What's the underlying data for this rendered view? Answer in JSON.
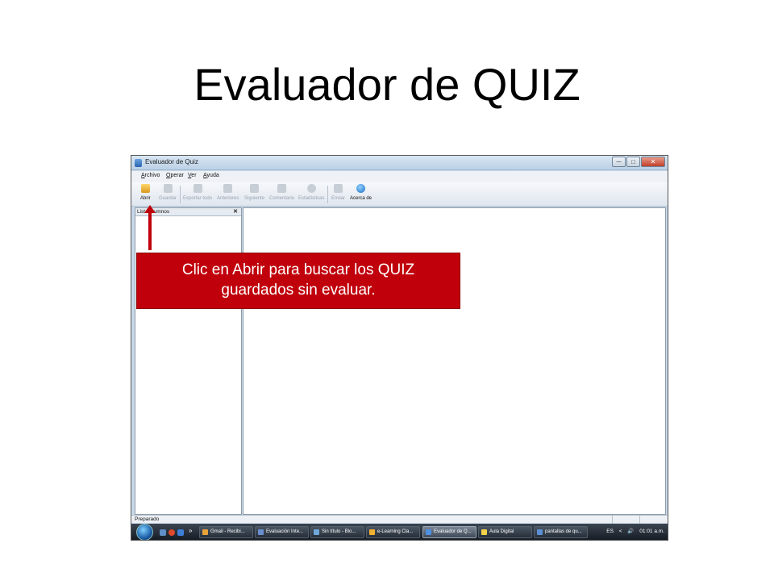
{
  "slide": {
    "title": "Evaluador de QUIZ"
  },
  "window": {
    "title": "Evaluador de Quiz",
    "controls": {
      "minimize": "─",
      "maximize": "□",
      "close": "✕"
    },
    "menu": [
      "Archivo",
      "Operar",
      "Ver",
      "Ayuda"
    ],
    "toolbar": [
      {
        "label": "Abrir",
        "icon": "folder-open-icon",
        "enabled": true
      },
      {
        "label": "Guardar",
        "icon": "save-icon",
        "enabled": false
      },
      {
        "label": "Exportar todo",
        "icon": "export-icon",
        "enabled": false
      },
      {
        "label": "Anteriores",
        "icon": "arrow-up-icon",
        "enabled": false
      },
      {
        "label": "Siguiente",
        "icon": "arrow-down-icon",
        "enabled": false
      },
      {
        "label": "Comentario",
        "icon": "comment-icon",
        "enabled": false
      },
      {
        "label": "Estadísticas",
        "icon": "stats-icon",
        "enabled": false
      },
      {
        "label": "Enviar",
        "icon": "send-icon",
        "enabled": false
      },
      {
        "label": "Acerca de",
        "icon": "help-icon",
        "enabled": true
      }
    ],
    "panel": {
      "title": "Lista alumnos",
      "close": "✕"
    },
    "status": "Preparado"
  },
  "taskbar": {
    "quicklaunch_more": "»",
    "tasks": [
      {
        "label": "Gmail - Recibi...",
        "color": "#e8a33a"
      },
      {
        "label": "Evaluación Inte...",
        "color": "#6a8fd0"
      },
      {
        "label": "Sin título - Blo...",
        "color": "#6fa8dc"
      },
      {
        "label": "e-Learning Cla...",
        "color": "#f0b030"
      },
      {
        "label": "Evaluador de Q...",
        "color": "#4d8fe0",
        "active": true
      },
      {
        "label": "Aula Digital",
        "color": "#f3d34a"
      },
      {
        "label": "pantallas de qu...",
        "color": "#5b8fd6"
      }
    ],
    "tray": {
      "lang": "ES",
      "chevron": "<",
      "volume": "🔊",
      "time": "01:01 a.m."
    }
  },
  "callout": {
    "line1": "Clic en Abrir para buscar los QUIZ",
    "line2": "guardados sin evaluar."
  },
  "colors": {
    "callout": "#c0000b",
    "arrow": "#c0000b"
  }
}
